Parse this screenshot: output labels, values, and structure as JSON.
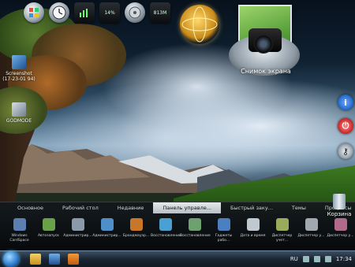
{
  "desktop": {
    "icons": [
      {
        "label": "Screenshot\n(17-23-01 94)"
      },
      {
        "label": "GODMODE"
      }
    ],
    "camera_gadget_label": "Снимок экрана",
    "recycle_bin_label": "Корзина"
  },
  "top_gadgets": [
    {
      "name": "windows-logo-icon",
      "text": ""
    },
    {
      "name": "clock-icon",
      "text": ""
    },
    {
      "name": "cpu-meter-icon",
      "text": ""
    },
    {
      "name": "cpu-usage-meter",
      "text": "14%"
    },
    {
      "name": "disk-icon",
      "text": ""
    },
    {
      "name": "memory-meter",
      "text": "813M"
    }
  ],
  "dock": {
    "tabs": [
      {
        "label": "Основное",
        "active": false
      },
      {
        "label": "Рабочий стол",
        "active": false
      },
      {
        "label": "Недавние",
        "active": false
      },
      {
        "label": "Панель управле...",
        "active": true
      },
      {
        "label": "Быстрый заку...",
        "active": false
      },
      {
        "label": "Темы",
        "active": false
      },
      {
        "label": "Процессы",
        "active": false
      }
    ],
    "items": [
      {
        "label": "Windows CardSpace",
        "color": "#5a7fb0"
      },
      {
        "label": "Автозапуск",
        "color": "#6aa04a"
      },
      {
        "label": "Администрир...",
        "color": "#8a9aa8"
      },
      {
        "label": "Администрир...",
        "color": "#4f8fc9"
      },
      {
        "label": "Брандмауэр...",
        "color": "#c8772a"
      },
      {
        "label": "Восстановление",
        "color": "#4aa0d0"
      },
      {
        "label": "Восстановление",
        "color": "#6fa070"
      },
      {
        "label": "Гаджеты рабо...",
        "color": "#4a7fc0"
      },
      {
        "label": "Дата и время",
        "color": "#c0c8d0"
      },
      {
        "label": "Диспетчер учет...",
        "color": "#9aab5a"
      },
      {
        "label": "Диспетчер у...",
        "color": "#a0a8b0"
      },
      {
        "label": "Диспетчер у...",
        "color": "#b06a8a"
      }
    ]
  },
  "taskbar": {
    "language": "RU",
    "time": "17:34"
  },
  "colors": {
    "close_button": "#d23030",
    "info_button": "#2a6fd0",
    "start_orb": "#2a7ad0"
  }
}
